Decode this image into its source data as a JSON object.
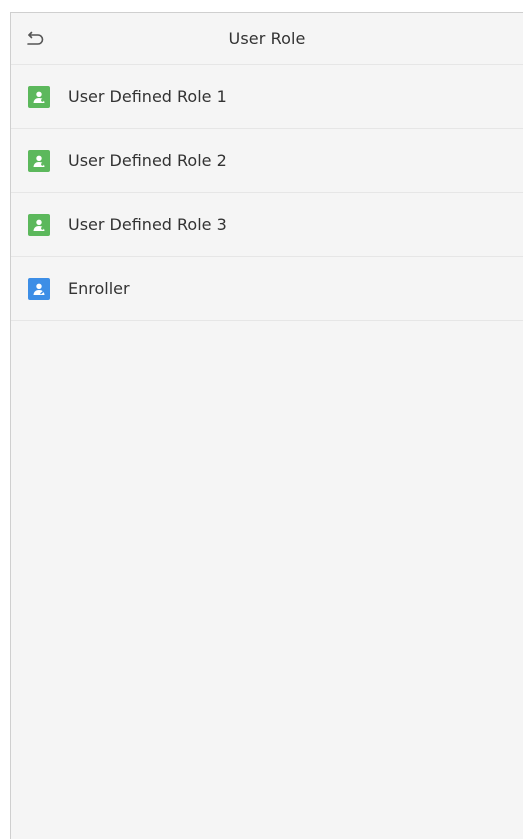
{
  "header": {
    "title": "User Role",
    "back_icon": "back-arrow-icon"
  },
  "colors": {
    "user_defined_role": "#5cb85c",
    "enroller": "#3d8ee6",
    "background": "#f5f5f5",
    "text": "#333333"
  },
  "roles": [
    {
      "label": "User Defined Role 1",
      "icon": "user-role-icon",
      "color": "#5cb85c"
    },
    {
      "label": "User Defined Role 2",
      "icon": "user-role-icon",
      "color": "#5cb85c"
    },
    {
      "label": "User Defined Role 3",
      "icon": "user-role-icon",
      "color": "#5cb85c"
    },
    {
      "label": "Enroller",
      "icon": "enroller-icon",
      "color": "#3d8ee6"
    }
  ]
}
